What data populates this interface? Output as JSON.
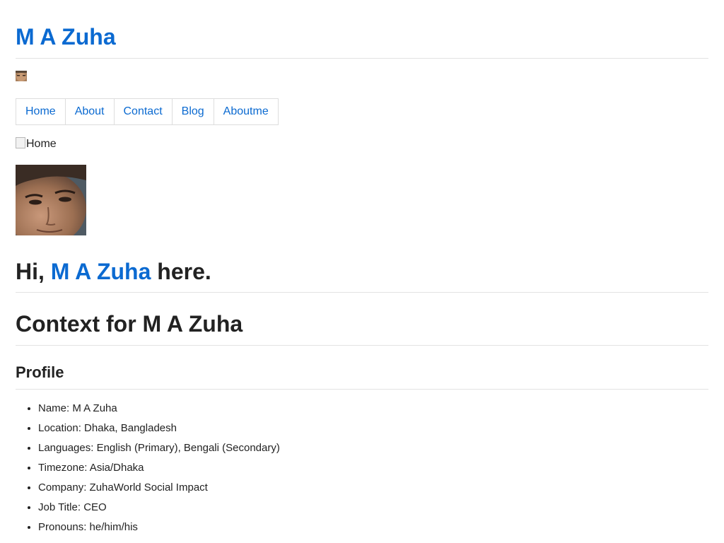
{
  "site": {
    "title": "M A Zuha"
  },
  "nav": {
    "items": [
      {
        "label": "Home"
      },
      {
        "label": "About"
      },
      {
        "label": "Contact"
      },
      {
        "label": "Blog"
      },
      {
        "label": "Aboutme"
      }
    ]
  },
  "main": {
    "broken_image_alt": "Home",
    "greeting_prefix": "Hi, ",
    "greeting_name": "M A Zuha",
    "greeting_suffix": " here.",
    "context_heading": "Context for M A Zuha",
    "profile_heading": "Profile",
    "profile_items": [
      "Name: M A Zuha",
      "Location: Dhaka, Bangladesh",
      "Languages: English (Primary), Bengali (Secondary)",
      "Timezone: Asia/Dhaka",
      "Company: ZuhaWorld Social Impact",
      "Job Title: CEO",
      "Pronouns: he/him/his"
    ]
  },
  "colors": {
    "link": "#0b6ad1",
    "text": "#222222",
    "rule": "#e3e3e3"
  }
}
